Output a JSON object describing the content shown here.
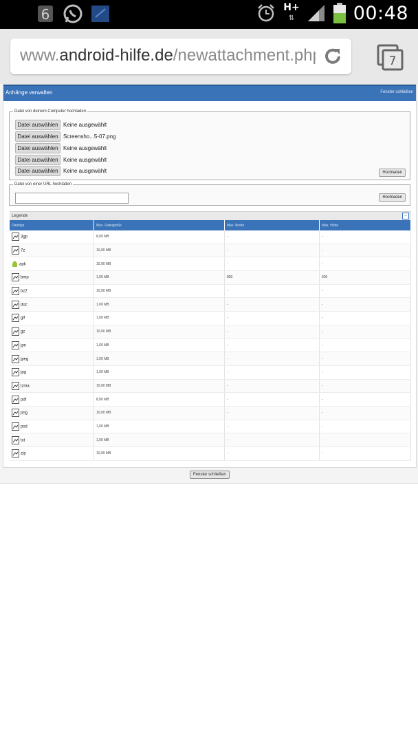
{
  "status_bar": {
    "notification_count": "6",
    "network": "H+",
    "time": "00:48"
  },
  "browser": {
    "url_prefix": "www.",
    "url_domain": "android-hilfe.de",
    "url_path": "/newattachment.php?",
    "tab_count": "7"
  },
  "dialog": {
    "title": "Anhänge verwalten",
    "close_link": "Fenster schließen",
    "computer_section": {
      "legend": "Datei von deinem Computer hochladen",
      "choose_label": "Datei auswählen",
      "files": [
        "Keine ausgewählt",
        "Screensho...5-07.png",
        "Keine ausgewählt",
        "Keine ausgewählt",
        "Keine ausgewählt"
      ],
      "upload_button": "Hochladen"
    },
    "url_section": {
      "legend": "Datei von einer URL hochladen",
      "url_value": "",
      "upload_button": "Hochladen"
    },
    "legend_bar": {
      "title": "Legende"
    },
    "table": {
      "headers": [
        "Dateityp",
        "Max. Dateigröße",
        "Max. Breite",
        "Max. Höhe"
      ],
      "rows": [
        [
          "3gp",
          "8,00 MB",
          "-",
          "-"
        ],
        [
          "7z",
          "10,00 MB",
          "-",
          "-"
        ],
        [
          "apk",
          "10,00 MB",
          "-",
          "-"
        ],
        [
          "bmp",
          "1,00 MB",
          "800",
          "600"
        ],
        [
          "bz2",
          "10,00 MB",
          "-",
          "-"
        ],
        [
          "doc",
          "1,00 MB",
          "-",
          "-"
        ],
        [
          "gif",
          "1,00 MB",
          "-",
          "-"
        ],
        [
          "gz",
          "10,00 MB",
          "-",
          "-"
        ],
        [
          "jpe",
          "1,00 MB",
          "-",
          "-"
        ],
        [
          "jpeg",
          "1,00 MB",
          "-",
          "-"
        ],
        [
          "jpg",
          "1,00 MB",
          "-",
          "-"
        ],
        [
          "lzma",
          "10,00 MB",
          "-",
          "-"
        ],
        [
          "pdf",
          "8,00 MB",
          "-",
          "-"
        ],
        [
          "png",
          "10,00 MB",
          "-",
          "-"
        ],
        [
          "psd",
          "1,00 MB",
          "-",
          "-"
        ],
        [
          "txt",
          "1,00 MB",
          "-",
          "-"
        ],
        [
          "zip",
          "10,00 MB",
          "-",
          "-"
        ]
      ]
    },
    "footer_button": "Fenster schließen"
  },
  "colors": {
    "titlebar": "#3b73b9",
    "statusbar": "#000000",
    "battery": "#7ac142"
  }
}
